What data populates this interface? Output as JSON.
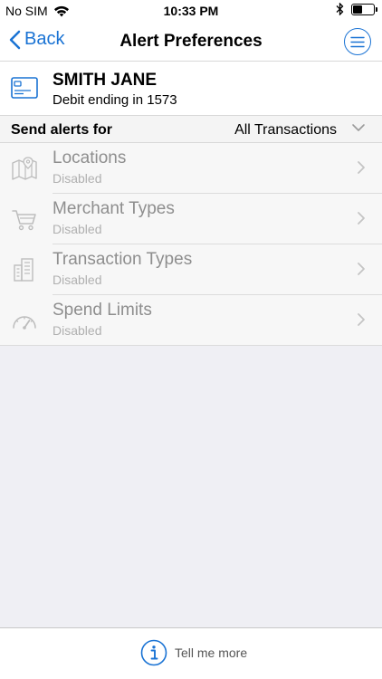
{
  "status_bar": {
    "carrier": "No SIM",
    "time": "10:33 PM",
    "battery_level": 0.45
  },
  "nav": {
    "back_label": "Back",
    "title": "Alert Preferences"
  },
  "account": {
    "name": "SMITH JANE",
    "subtitle": "Debit ending in 1573"
  },
  "send_alerts": {
    "label": "Send alerts for",
    "value": "All Transactions"
  },
  "preferences": [
    {
      "title": "Locations",
      "status": "Disabled",
      "icon": "map-icon"
    },
    {
      "title": "Merchant Types",
      "status": "Disabled",
      "icon": "cart-icon"
    },
    {
      "title": "Transaction Types",
      "status": "Disabled",
      "icon": "building-icon"
    },
    {
      "title": "Spend Limits",
      "status": "Disabled",
      "icon": "gauge-icon"
    }
  ],
  "footer": {
    "tell_more_label": "Tell me more"
  },
  "colors": {
    "accent": "#1a73d4",
    "disabled_text": "#8e8e8e",
    "background": "#efeff4"
  }
}
